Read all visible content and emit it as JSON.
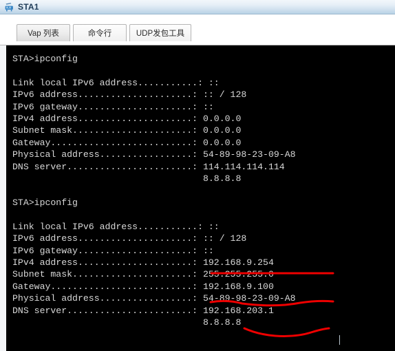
{
  "window": {
    "title": "STA1",
    "icon": "device-station-icon"
  },
  "tabs": [
    {
      "label": "Vap 列表",
      "selected": true
    },
    {
      "label": "命令行",
      "selected": false
    },
    {
      "label": "UDP发包工具",
      "selected": false
    }
  ],
  "terminal": {
    "prompt_symbol": "STA>",
    "background_color": "#000000",
    "text_color": "#d8d8d8",
    "blocks": [
      {
        "command": "STA>ipconfig",
        "entries": [
          {
            "label": "Link local IPv6 address",
            "value": "::"
          },
          {
            "label": "IPv6 address",
            "value": ":: / 128"
          },
          {
            "label": "IPv6 gateway",
            "value": "::"
          },
          {
            "label": "IPv4 address",
            "value": "0.0.0.0"
          },
          {
            "label": "Subnet mask",
            "value": "0.0.0.0"
          },
          {
            "label": "Gateway",
            "value": "0.0.0.0"
          },
          {
            "label": "Physical address",
            "value": "54-89-98-23-09-A8"
          },
          {
            "label": "DNS server",
            "value": "114.114.114.114",
            "value2": "8.8.8.8"
          }
        ]
      },
      {
        "command": "STA>ipconfig",
        "entries": [
          {
            "label": "Link local IPv6 address",
            "value": "::"
          },
          {
            "label": "IPv6 address",
            "value": ":: / 128"
          },
          {
            "label": "IPv6 gateway",
            "value": "::"
          },
          {
            "label": "IPv4 address",
            "value": "192.168.9.254"
          },
          {
            "label": "Subnet mask",
            "value": "255.255.255.0"
          },
          {
            "label": "Gateway",
            "value": "192.168.9.100"
          },
          {
            "label": "Physical address",
            "value": "54-89-98-23-09-A8"
          },
          {
            "label": "DNS server",
            "value": "192.168.203.1",
            "value2": "8.8.8.8"
          }
        ]
      }
    ],
    "raw_text": "STA>ipconfig\n\nLink local IPv6 address...........: ::\nIPv6 address.....................: :: / 128\nIPv6 gateway.....................: ::\nIPv4 address.....................: 0.0.0.0\nSubnet mask......................: 0.0.0.0\nGateway..........................: 0.0.0.0\nPhysical address.................: 54-89-98-23-09-A8\nDNS server.......................: 114.114.114.114\n                                   8.8.8.8\n\nSTA>ipconfig\n\nLink local IPv6 address...........: ::\nIPv6 address.....................: :: / 128\nIPv6 gateway.....................: ::\nIPv4 address.....................: 192.168.9.254\nSubnet mask......................: 255.255.255.0\nGateway..........................: 192.168.9.100\nPhysical address.................: 54-89-98-23-09-A8\nDNS server.......................: 192.168.203.1\n                                   8.8.8.8"
  },
  "annotations": {
    "color": "#ee0000",
    "marks": [
      {
        "name": "underline-ipv4-address",
        "target": "192.168.9.254",
        "style": "straight-underline"
      },
      {
        "name": "underline-gateway",
        "target": "192.168.9.100",
        "style": "wavy-underline"
      },
      {
        "name": "strikethrough-dns-secondary",
        "target": "8.8.8.8",
        "style": "wavy-strike"
      }
    ]
  }
}
